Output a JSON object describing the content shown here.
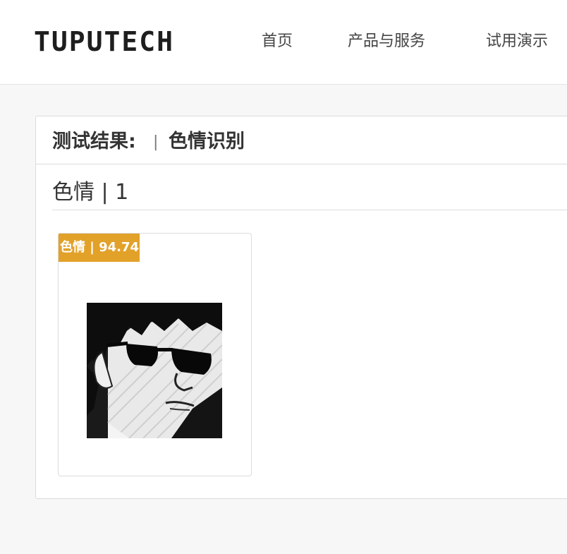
{
  "header": {
    "logo": "TUPUTECH",
    "nav": [
      {
        "label": "首页"
      },
      {
        "label": "产品与服务"
      },
      {
        "label": "试用演示"
      }
    ]
  },
  "result": {
    "label": "测试结果:",
    "separator": "|",
    "task": "色情识别",
    "section_title": "色情 | 1",
    "items": [
      {
        "badge": "色情 | 94.74",
        "image_icon": "anime-face-image"
      }
    ]
  },
  "colors": {
    "badge": "#e2a128",
    "page_bg": "#f7f7f7"
  }
}
